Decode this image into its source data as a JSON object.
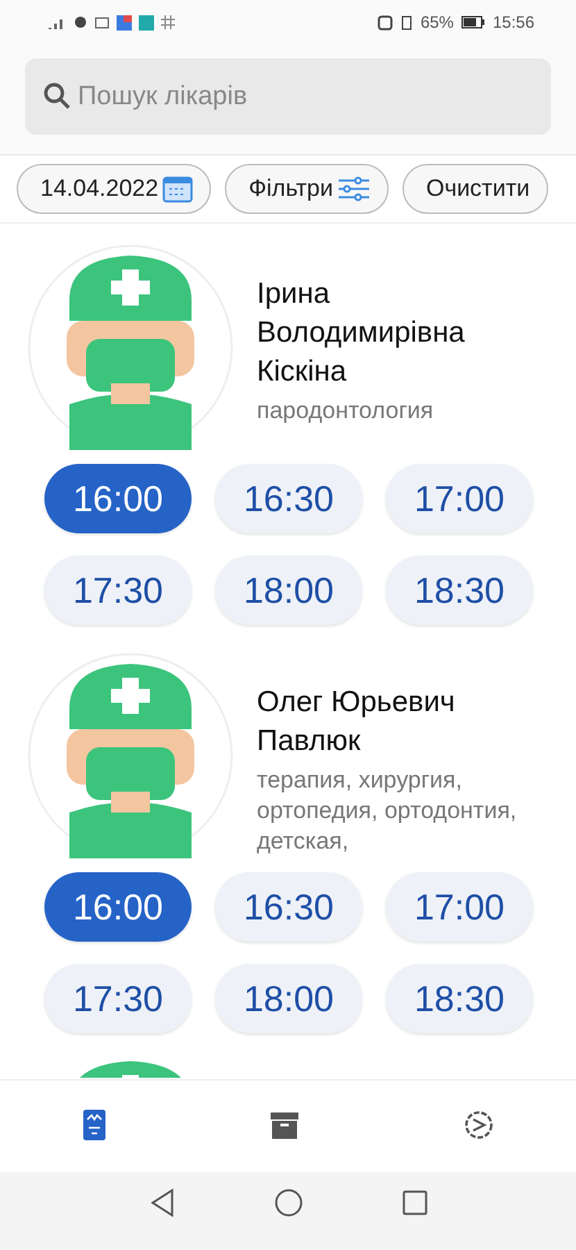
{
  "status_bar": {
    "battery": "65%",
    "time": "15:56"
  },
  "search": {
    "placeholder": "Пошук лікарів"
  },
  "chips": [
    {
      "kind": "date",
      "label": "14.04.2022"
    },
    {
      "kind": "filter",
      "label": "Фільтри"
    },
    {
      "kind": "plain",
      "label": "Очистити"
    }
  ],
  "doctors": [
    {
      "kind": "full",
      "name": "Ірина Володимирівна Кіскіна",
      "specialty": "пародонтология",
      "slots": [
        {
          "time": "16:00",
          "selected": true
        },
        {
          "time": "16:30",
          "selected": false
        },
        {
          "time": "17:00",
          "selected": false
        },
        {
          "time": "17:30",
          "selected": false
        },
        {
          "time": "18:00",
          "selected": false
        },
        {
          "time": "18:30",
          "selected": false
        }
      ]
    },
    {
      "kind": "full",
      "name": "Олег Юрьевич Павлюк",
      "specialty": "терапия, хирургия, ортопедия, ортодонтия, детская,",
      "slots": [
        {
          "time": "16:00",
          "selected": true
        },
        {
          "time": "16:30",
          "selected": false
        },
        {
          "time": "17:00",
          "selected": false
        },
        {
          "time": "17:30",
          "selected": false
        },
        {
          "time": "18:00",
          "selected": false
        },
        {
          "time": "18:30",
          "selected": false
        }
      ]
    },
    {
      "kind": "cut"
    }
  ],
  "bottom_nav": [
    {
      "kind": "schedule",
      "selected": true
    },
    {
      "kind": "archive",
      "selected": false
    },
    {
      "kind": "settings",
      "selected": false
    }
  ]
}
